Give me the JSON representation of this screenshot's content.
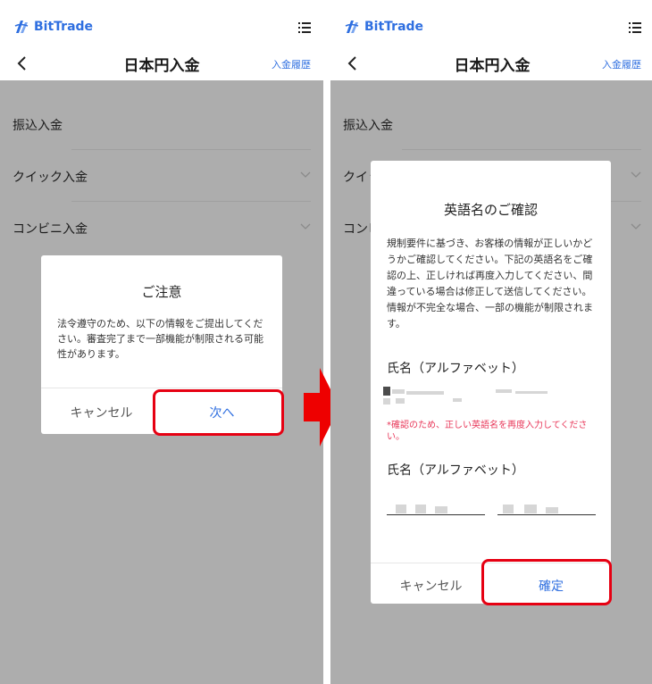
{
  "brand": {
    "name": "BitTrade",
    "color": "#2f6fe0"
  },
  "header": {
    "title": "日本円入金",
    "history_link": "入金履歴"
  },
  "deposit_methods": [
    {
      "label": "振込入金",
      "has_chevron": false
    },
    {
      "label": "クイック入金",
      "has_chevron": true
    },
    {
      "label": "コンビニ入金",
      "has_chevron": true
    }
  ],
  "notice_dialog": {
    "title": "ご注意",
    "body": "法令遵守のため、以下の情報をご提出してください。審査完了まで一部機能が制限される可能性があります。",
    "cancel_label": "キャンセル",
    "next_label": "次へ"
  },
  "confirm_dialog": {
    "title": "英語名のご確認",
    "body": "規制要件に基づき、お客様の情報が正しいかどうかご確認してください。下記の英語名をご確認の上、正しければ再度入力してください、間違っている場合は修正して送信してください。 情報が不完全な場合、一部の機能が制限されます。",
    "field1_label": "氏名（アルファベット）",
    "warning": "*確認のため、正しい英語名を再度入力してください。",
    "field2_label": "氏名（アルファベット）",
    "cancel_label": "キャンセル",
    "confirm_label": "確定"
  },
  "colors": {
    "overlay": "#adadad",
    "highlight": "#e60012",
    "warning": "#e8385a",
    "link": "#2f6fe0"
  }
}
